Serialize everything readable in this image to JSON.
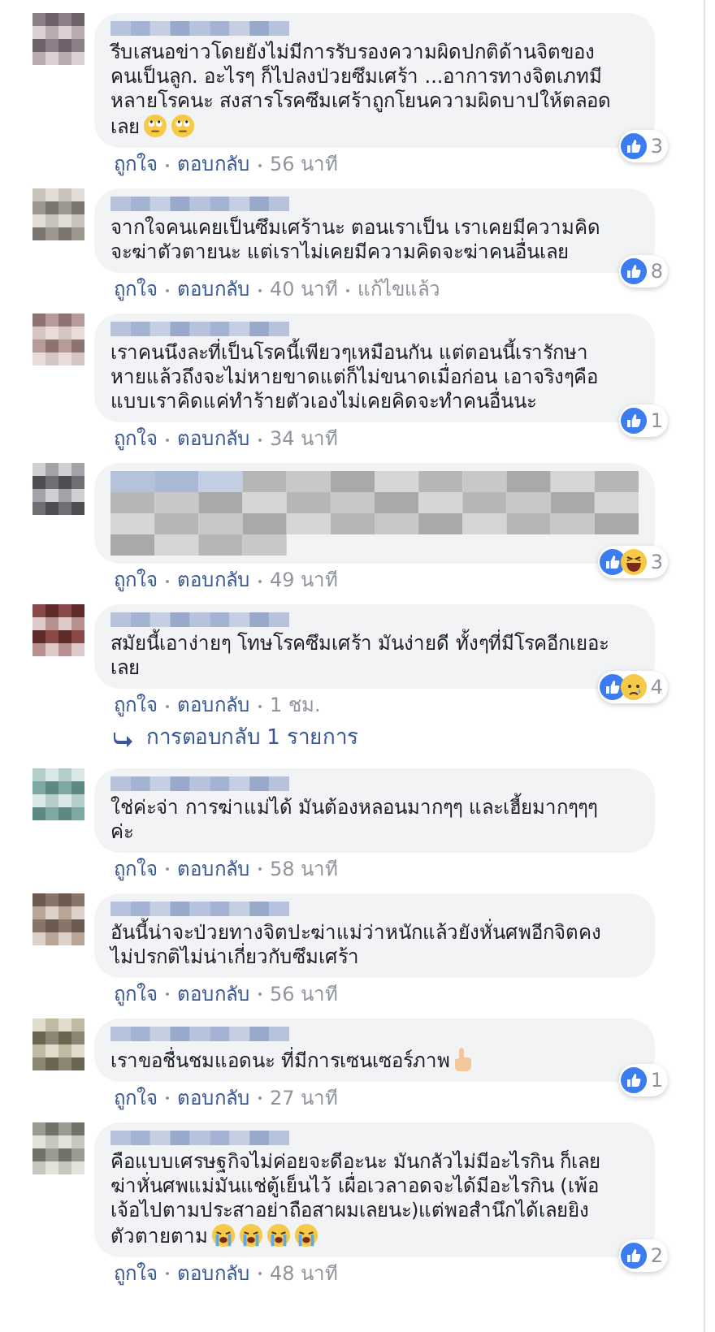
{
  "comments": [
    {
      "kind": "text",
      "text": "รีบเสนอข่าวโดยยังไม่มีการรับรองความผิดปกติด้านจิตของคนเป็นลูก. อะไรๆ ก็ไปลงป่วยซึมเศร้า ...อาการทางจิตเภทมีหลายโรคนะ สงสารโรคซึมเศร้าถูกโยนความผิดบาปให้ตลอดเลย",
      "emoji": [
        {
          "kind": "rolling-eyes"
        },
        {
          "kind": "rolling-eyes"
        }
      ],
      "reactions": [
        {
          "kind": "like"
        }
      ],
      "count": "3",
      "actions": [
        "ถูกใจ",
        "ตอบกลับ",
        "56 นาที"
      ]
    },
    {
      "kind": "text",
      "text": "จากใจคนเคยเป็นซึมเศร้านะ ตอนเราเป็น เราเคยมีความคิดจะฆ่าตัวตายนะ แต่เราไม่เคยมีความคิดจะฆ่าคนอื่นเลย",
      "reactions": [
        {
          "kind": "like"
        }
      ],
      "count": "8",
      "actions": [
        "ถูกใจ",
        "ตอบกลับ",
        "40 นาที",
        "แก้ไขแล้ว"
      ]
    },
    {
      "kind": "text",
      "text": "เราคนนึงละที่เป็นโรคนี้เพียวๆเหมือนกัน แต่ตอนนี้เรารักษาหายแล้วถึงจะไม่หายขาดแต่ก็ไม่ขนาดเมื่อก่อน เอาจริงๆคือแบบเราคิดแค่ทำร้ายตัวเองไม่เคยคิดจะทำคนอื่นนะ",
      "reactions": [
        {
          "kind": "like"
        }
      ],
      "count": "1",
      "actions": [
        "ถูกใจ",
        "ตอบกลับ",
        "34 นาที"
      ]
    },
    {
      "kind": "blurred",
      "reactions": [
        {
          "kind": "like"
        },
        {
          "kind": "haha"
        }
      ],
      "count": "3",
      "actions": [
        "ถูกใจ",
        "ตอบกลับ",
        "49 นาที"
      ]
    },
    {
      "kind": "text",
      "text": "สมัยนี้เอาง่ายๆ โทษโรคซึมเศร้า มันง่ายดี ทั้งๆที่มีโรคอีกเยอะเลย",
      "reactions": [
        {
          "kind": "like"
        },
        {
          "kind": "sad"
        }
      ],
      "count": "4",
      "actions": [
        "ถูกใจ",
        "ตอบกลับ",
        "1 ชม."
      ],
      "replies": "การตอบกลับ 1 รายการ"
    },
    {
      "kind": "text",
      "text": "ใช่ค่ะจ่า การฆ่าแม่ได้ มันต้องหลอนมากๆๆ และเฮี้ยมากๆๆๆค่ะ",
      "actions": [
        "ถูกใจ",
        "ตอบกลับ",
        "58 นาที"
      ]
    },
    {
      "kind": "text",
      "text": "อันนี้น่าจะป่วยทางจิตปะฆ่าแม่ว่าหนักแล้วยังหั่นศพอีกจิตคงไม่ปรกติไม่น่าเกี่ยวกับซึมเศร้า",
      "actions": [
        "ถูกใจ",
        "ตอบกลับ",
        "56 นาที"
      ]
    },
    {
      "kind": "text",
      "text": "เราขอชื่นชมแอดนะ ที่มีการเซนเซอร์ภาพ",
      "emoji": [
        {
          "kind": "hand"
        }
      ],
      "reactions": [
        {
          "kind": "like"
        }
      ],
      "count": "1",
      "actions": [
        "ถูกใจ",
        "ตอบกลับ",
        "27 นาที"
      ]
    },
    {
      "kind": "text",
      "text": "คือแบบเศรษฐกิจไม่ค่อยจะดีอะนะ มันกลัวไม่มีอะไรกิน ก็เลยฆ่าหั่นศพแม่มันแช่ตู้เย็นไว้ เผื่อเวลาอดจะได้มีอะไรกิน (เพ้อเจ้อไปตามประสาอย่าถือสาผมเลยนะ)แต่พอสำนึกได้เลยยิงตัวตายตาม",
      "emoji": [
        {
          "kind": "crying"
        },
        {
          "kind": "crying"
        },
        {
          "kind": "crying"
        },
        {
          "kind": "crying"
        }
      ],
      "reactions": [
        {
          "kind": "like"
        }
      ],
      "count": "2",
      "actions": [
        "ถูกใจ",
        "ตอบกลับ",
        "48 นาที"
      ]
    }
  ]
}
